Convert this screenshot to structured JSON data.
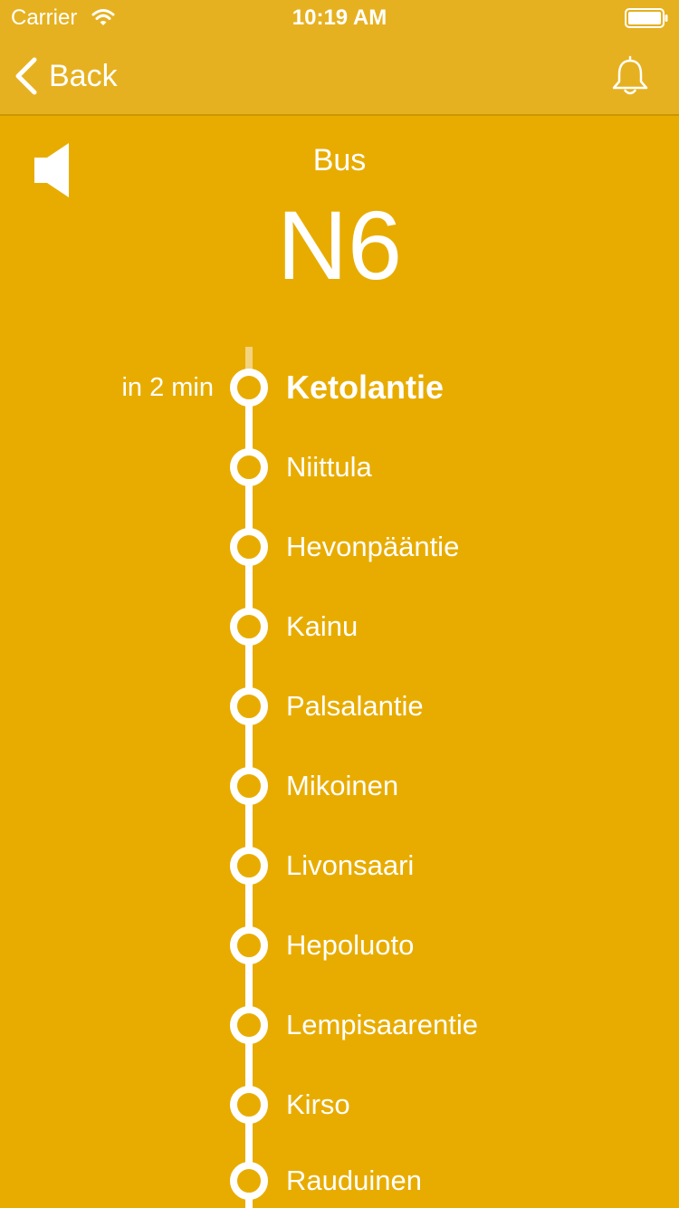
{
  "status_bar": {
    "carrier": "Carrier",
    "time": "10:19 AM"
  },
  "nav": {
    "back_label": "Back"
  },
  "vehicle": {
    "type": "Bus",
    "line": "N6"
  },
  "stops": [
    {
      "name": "Ketolantie",
      "eta": "in 2 min",
      "current": true
    },
    {
      "name": "Niittula",
      "eta": "",
      "current": false
    },
    {
      "name": "Hevonpääntie",
      "eta": "",
      "current": false
    },
    {
      "name": "Kainu",
      "eta": "",
      "current": false
    },
    {
      "name": "Palsalantie",
      "eta": "",
      "current": false
    },
    {
      "name": "Mikoinen",
      "eta": "",
      "current": false
    },
    {
      "name": "Livonsaari",
      "eta": "",
      "current": false
    },
    {
      "name": "Hepoluoto",
      "eta": "",
      "current": false
    },
    {
      "name": "Lempisaarentie",
      "eta": "",
      "current": false
    },
    {
      "name": "Kirso",
      "eta": "",
      "current": false
    },
    {
      "name": "Rauduinen",
      "eta": "",
      "current": false
    }
  ],
  "icons": {
    "wifi": "wifi-icon",
    "battery": "battery-icon",
    "back": "chevron-left-icon",
    "alert": "bell-icon",
    "sound": "speaker-icon"
  },
  "colors": {
    "background": "#E8AC00",
    "nav_bar": "#E6B120",
    "foreground": "#FFFFFF"
  }
}
